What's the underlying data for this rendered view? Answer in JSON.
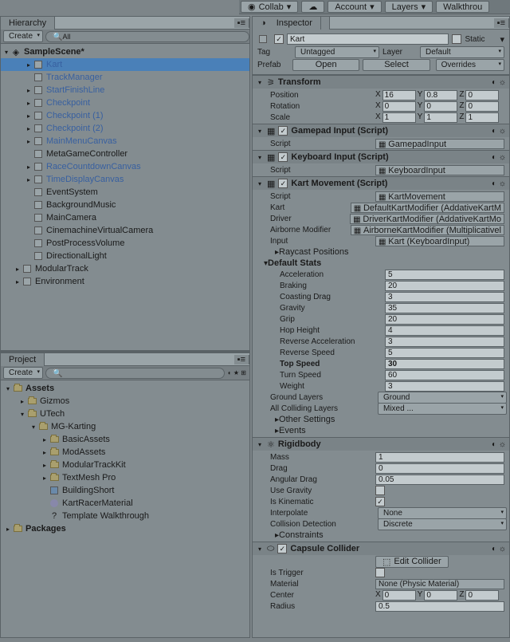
{
  "toolbar": {
    "collab": "Collab",
    "account": "Account",
    "layers": "Layers",
    "walkthrough": "Walkthrou"
  },
  "hierarchy": {
    "title": "Hierarchy",
    "createBtn": "Create",
    "search": "All",
    "root": {
      "name": "SampleScene*",
      "expanded": true
    },
    "items": [
      {
        "name": "Kart",
        "indent": 1,
        "blue": true,
        "selected": true,
        "triangle": "▸"
      },
      {
        "name": "TrackManager",
        "indent": 1,
        "blue": true
      },
      {
        "name": "StartFinishLine",
        "indent": 1,
        "blue": true,
        "triangle": "▸"
      },
      {
        "name": "Checkpoint",
        "indent": 1,
        "blue": true,
        "triangle": "▸"
      },
      {
        "name": "Checkpoint (1)",
        "indent": 1,
        "blue": true,
        "triangle": "▸"
      },
      {
        "name": "Checkpoint (2)",
        "indent": 1,
        "blue": true,
        "triangle": "▸"
      },
      {
        "name": "MainMenuCanvas",
        "indent": 1,
        "blue": true,
        "triangle": "▸"
      },
      {
        "name": "MetaGameController",
        "indent": 1
      },
      {
        "name": "RaceCountdownCanvas",
        "indent": 1,
        "blue": true,
        "triangle": "▸"
      },
      {
        "name": "TimeDisplayCanvas",
        "indent": 1,
        "blue": true,
        "triangle": "▸"
      },
      {
        "name": "EventSystem",
        "indent": 1
      },
      {
        "name": "BackgroundMusic",
        "indent": 1
      },
      {
        "name": "MainCamera",
        "indent": 1
      },
      {
        "name": "CinemachineVirtualCamera",
        "indent": 1
      },
      {
        "name": "PostProcessVolume",
        "indent": 1
      },
      {
        "name": "DirectionalLight",
        "indent": 1
      },
      {
        "name": "ModularTrack",
        "indent": 0,
        "triangle": "▸"
      },
      {
        "name": "Environment",
        "indent": 0,
        "triangle": "▸"
      }
    ]
  },
  "project": {
    "title": "Project",
    "createBtn": "Create",
    "assets": {
      "label": "Assets",
      "items": [
        {
          "name": "Gizmos",
          "indent": 1
        },
        {
          "name": "UTech",
          "indent": 1,
          "expanded": true
        },
        {
          "name": "MG-Karting",
          "indent": 2,
          "expanded": true
        },
        {
          "name": "BasicAssets",
          "indent": 3
        },
        {
          "name": "ModAssets",
          "indent": 3
        },
        {
          "name": "ModularTrackKit",
          "indent": 3
        },
        {
          "name": "TextMesh Pro",
          "indent": 3
        },
        {
          "name": "BuildingShort",
          "indent": 3,
          "type": "prefab"
        },
        {
          "name": "KartRacerMaterial",
          "indent": 3,
          "type": "material"
        },
        {
          "name": "Template Walkthrough",
          "indent": 3,
          "type": "doc"
        }
      ]
    },
    "packages": {
      "label": "Packages"
    }
  },
  "inspector": {
    "title": "Inspector",
    "name": "Kart",
    "static": "Static",
    "tagLbl": "Tag",
    "tag": "Untagged",
    "layerLbl": "Layer",
    "layer": "Default",
    "prefabLbl": "Prefab",
    "prefabOpen": "Open",
    "prefabSelect": "Select",
    "prefabOverrides": "Overrides",
    "transform": {
      "title": "Transform",
      "position": "Position",
      "px": "16",
      "py": "0.8",
      "pz": "0",
      "rotation": "Rotation",
      "rx": "0",
      "ry": "0",
      "rz": "0",
      "scale": "Scale",
      "sx": "1",
      "sy": "1",
      "sz": "1"
    },
    "gamepad": {
      "title": "Gamepad Input (Script)",
      "scriptLbl": "Script",
      "script": "GamepadInput"
    },
    "keyboard": {
      "title": "Keyboard Input (Script)",
      "scriptLbl": "Script",
      "script": "KeyboardInput"
    },
    "movement": {
      "title": "Kart Movement (Script)",
      "scriptLbl": "Script",
      "script": "KartMovement",
      "kartLbl": "Kart",
      "kart": "DefaultKartModifier (AddativeKartM",
      "driverLbl": "Driver",
      "driver": "DriverKartModifier (AddativeKartMo",
      "airborneLbl": "Airborne Modifier",
      "airborne": "AirborneKartModifier (Multiplicativel",
      "inputLbl": "Input",
      "input": "Kart (KeyboardInput)",
      "raycast": "Raycast Positions",
      "defaultStats": "Default Stats",
      "stats": [
        {
          "n": "Acceleration",
          "v": "5"
        },
        {
          "n": "Braking",
          "v": "20"
        },
        {
          "n": "Coasting Drag",
          "v": "3"
        },
        {
          "n": "Gravity",
          "v": "35"
        },
        {
          "n": "Grip",
          "v": "20"
        },
        {
          "n": "Hop Height",
          "v": "4"
        },
        {
          "n": "Reverse Acceleration",
          "v": "3"
        },
        {
          "n": "Reverse Speed",
          "v": "5"
        },
        {
          "n": "Top Speed",
          "v": "30",
          "bold": true
        },
        {
          "n": "Turn Speed",
          "v": "60"
        },
        {
          "n": "Weight",
          "v": "3"
        }
      ],
      "groundLayersLbl": "Ground Layers",
      "groundLayers": "Ground",
      "allCollidingLbl": "All Colliding Layers",
      "allColliding": "Mixed ...",
      "otherSettings": "Other Settings",
      "events": "Events"
    },
    "rigidbody": {
      "title": "Rigidbody",
      "props": [
        {
          "n": "Mass",
          "v": "1"
        },
        {
          "n": "Drag",
          "v": "0"
        },
        {
          "n": "Angular Drag",
          "v": "0.05"
        }
      ],
      "useGravityLbl": "Use Gravity",
      "isKinematicLbl": "Is Kinematic",
      "interpolateLbl": "Interpolate",
      "interpolate": "None",
      "collisionLbl": "Collision Detection",
      "collision": "Discrete",
      "constraints": "Constraints"
    },
    "capsule": {
      "title": "Capsule Collider",
      "editCollider": "Edit Collider",
      "isTriggerLbl": "Is Trigger",
      "materialLbl": "Material",
      "material": "None (Physic Material)",
      "centerLbl": "Center",
      "cx": "0",
      "cy": "0",
      "cz": "0",
      "radiusLbl": "Radius",
      "radius": "0.5"
    }
  }
}
